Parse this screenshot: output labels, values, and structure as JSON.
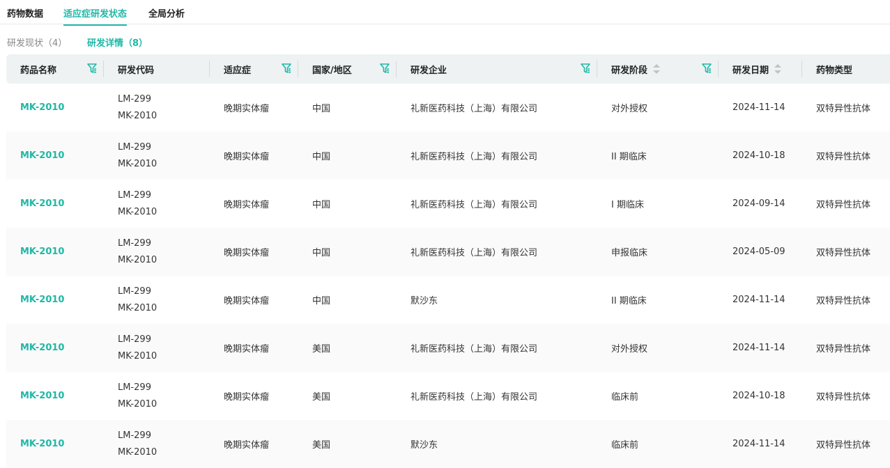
{
  "tabs": [
    "药物数据",
    "适应症研发状态",
    "全局分析"
  ],
  "subtabs": [
    "研发现状（4）",
    "研发详情（8）"
  ],
  "columns": [
    "药品名称",
    "研发代码",
    "适应症",
    "国家/地区",
    "研发企业",
    "研发阶段",
    "研发日期",
    "药物类型"
  ],
  "rows": [
    {
      "name": "MK-2010",
      "code1": "LM-299",
      "code2": "MK-2010",
      "ind": "晚期实体瘤",
      "region": "中国",
      "company": "礼新医药科技（上海）有限公司",
      "stage": "对外授权",
      "date": "2024-11-14",
      "type": "双特异性抗体"
    },
    {
      "name": "MK-2010",
      "code1": "LM-299",
      "code2": "MK-2010",
      "ind": "晚期实体瘤",
      "region": "中国",
      "company": "礼新医药科技（上海）有限公司",
      "stage": "II 期临床",
      "date": "2024-10-18",
      "type": "双特异性抗体"
    },
    {
      "name": "MK-2010",
      "code1": "LM-299",
      "code2": "MK-2010",
      "ind": "晚期实体瘤",
      "region": "中国",
      "company": "礼新医药科技（上海）有限公司",
      "stage": "I 期临床",
      "date": "2024-09-14",
      "type": "双特异性抗体"
    },
    {
      "name": "MK-2010",
      "code1": "LM-299",
      "code2": "MK-2010",
      "ind": "晚期实体瘤",
      "region": "中国",
      "company": "礼新医药科技（上海）有限公司",
      "stage": "申报临床",
      "date": "2024-05-09",
      "type": "双特异性抗体"
    },
    {
      "name": "MK-2010",
      "code1": "LM-299",
      "code2": "MK-2010",
      "ind": "晚期实体瘤",
      "region": "中国",
      "company": "默沙东",
      "stage": "II 期临床",
      "date": "2024-11-14",
      "type": "双特异性抗体"
    },
    {
      "name": "MK-2010",
      "code1": "LM-299",
      "code2": "MK-2010",
      "ind": "晚期实体瘤",
      "region": "美国",
      "company": "礼新医药科技（上海）有限公司",
      "stage": "对外授权",
      "date": "2024-11-14",
      "type": "双特异性抗体"
    },
    {
      "name": "MK-2010",
      "code1": "LM-299",
      "code2": "MK-2010",
      "ind": "晚期实体瘤",
      "region": "美国",
      "company": "礼新医药科技（上海）有限公司",
      "stage": "临床前",
      "date": "2024-10-18",
      "type": "双特异性抗体"
    },
    {
      "name": "MK-2010",
      "code1": "LM-299",
      "code2": "MK-2010",
      "ind": "晚期实体瘤",
      "region": "美国",
      "company": "默沙东",
      "stage": "临床前",
      "date": "2024-11-14",
      "type": "双特异性抗体"
    }
  ],
  "accent": "#1fb8a6"
}
